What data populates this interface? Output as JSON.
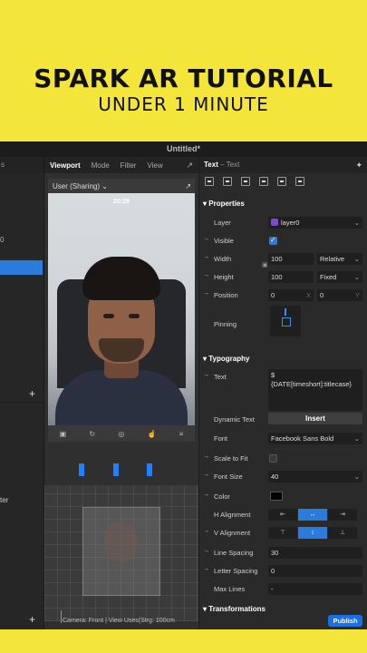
{
  "banner": {
    "title": "SPARK AR TUTORIAL",
    "subtitle": "UNDER 1 MINUTE"
  },
  "window": {
    "title": "Untitled*"
  },
  "left_panel": {
    "header": "s",
    "value": "0",
    "item": "ter"
  },
  "viewport": {
    "tabs": [
      "Viewport",
      "Mode",
      "Filter",
      "View"
    ],
    "device": "User (Sharing)",
    "clock": "20:28",
    "status": "Camera: Front | View Uses(Strg: 100cm"
  },
  "inspector": {
    "object": "Text",
    "object_type": "– Text",
    "sections": {
      "properties": "Properties",
      "typography": "Typography",
      "transformations": "Transformations"
    },
    "layer": {
      "label": "Layer",
      "value": "layer0"
    },
    "visible": {
      "label": "Visible",
      "checked": true
    },
    "width": {
      "label": "Width",
      "value": "100",
      "mode": "Relative"
    },
    "height": {
      "label": "Height",
      "value": "100",
      "mode": "Fixed"
    },
    "position": {
      "label": "Position",
      "x": "0",
      "y": "0",
      "x_axis": "X",
      "y_axis": "Y"
    },
    "pinning": {
      "label": "Pinning"
    },
    "text": {
      "label": "Text",
      "value": "$\n{DATE[timeshort]:titlecase}"
    },
    "dynamic_text": {
      "label": "Dynamic Text",
      "button": "Insert"
    },
    "font": {
      "label": "Font",
      "value": "Facebook Sans Bold"
    },
    "scale_to_fit": {
      "label": "Scale to Fit",
      "checked": false
    },
    "font_size": {
      "label": "Font Size",
      "value": "40"
    },
    "color": {
      "label": "Color",
      "value": "#000000"
    },
    "h_alignment": {
      "label": "H Alignment",
      "selected": 1
    },
    "v_alignment": {
      "label": "V Alignment",
      "selected": 1
    },
    "line_spacing": {
      "label": "Line Spacing",
      "value": "30"
    },
    "letter_spacing": {
      "label": "Letter Spacing",
      "value": "0"
    },
    "max_lines": {
      "label": "Max Lines",
      "value": "-"
    },
    "publish": "Publish"
  },
  "colors": {
    "accent": "#2b7bdc",
    "banner": "#f4e53a",
    "layer": "#7a4bd0"
  }
}
